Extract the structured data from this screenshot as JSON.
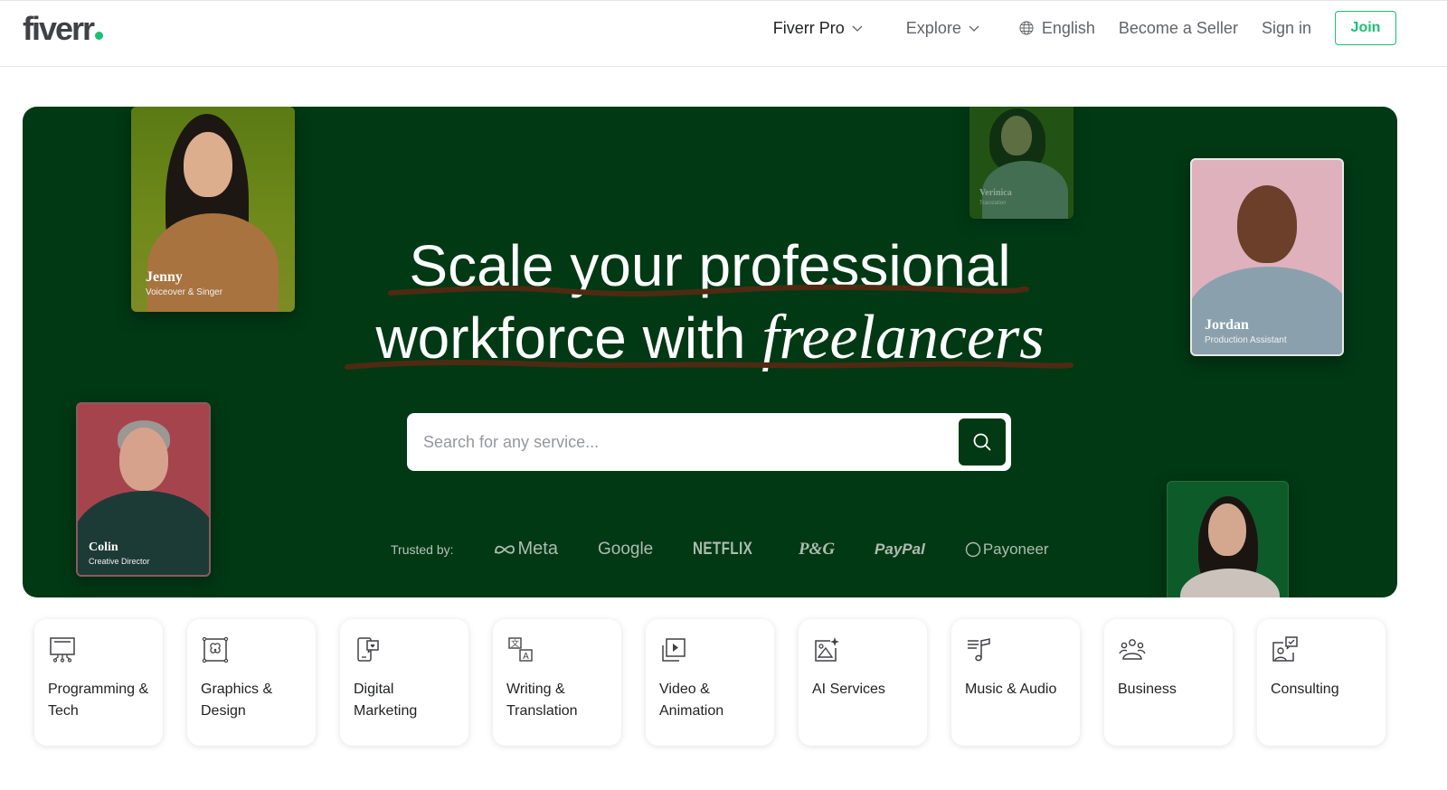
{
  "header": {
    "logo_text": "fiverr",
    "nav": {
      "fiverr_pro": "Fiverr Pro",
      "explore": "Explore",
      "language": "English",
      "become_seller": "Become a Seller",
      "sign_in": "Sign in",
      "join": "Join"
    }
  },
  "hero": {
    "headline_line1": "Scale your professional",
    "headline_line2_plain": "workforce with",
    "headline_line2_em": "freelancers",
    "search": {
      "placeholder": "Search for any service...",
      "value": ""
    },
    "trusted_label": "Trusted by:",
    "brands": [
      "Meta",
      "Google",
      "NETFLIX",
      "P&G",
      "PayPal",
      "Payoneer"
    ],
    "freelancers": [
      {
        "name": "Jenny",
        "role": "Voiceover & Singer"
      },
      {
        "name": "Verinica",
        "role": "Translation"
      },
      {
        "name": "Jordan",
        "role": "Production Assistant"
      },
      {
        "name": "Colin",
        "role": "Creative Director"
      }
    ]
  },
  "categories": [
    {
      "label": "Programming & Tech",
      "icon": "monitor-circuit-icon"
    },
    {
      "label": "Graphics & Design",
      "icon": "vector-shape-icon"
    },
    {
      "label": "Digital Marketing",
      "icon": "phone-heart-icon"
    },
    {
      "label": "Writing & Translation",
      "icon": "translate-icon"
    },
    {
      "label": "Video & Animation",
      "icon": "video-play-icon"
    },
    {
      "label": "AI Services",
      "icon": "ai-image-sparkle-icon"
    },
    {
      "label": "Music & Audio",
      "icon": "music-note-icon"
    },
    {
      "label": "Business",
      "icon": "people-group-icon"
    },
    {
      "label": "Consulting",
      "icon": "consultant-chat-icon"
    }
  ],
  "colors": {
    "brand_green": "#1dbf73",
    "hero_bg": "#013914",
    "underline": "#4f2a12"
  }
}
